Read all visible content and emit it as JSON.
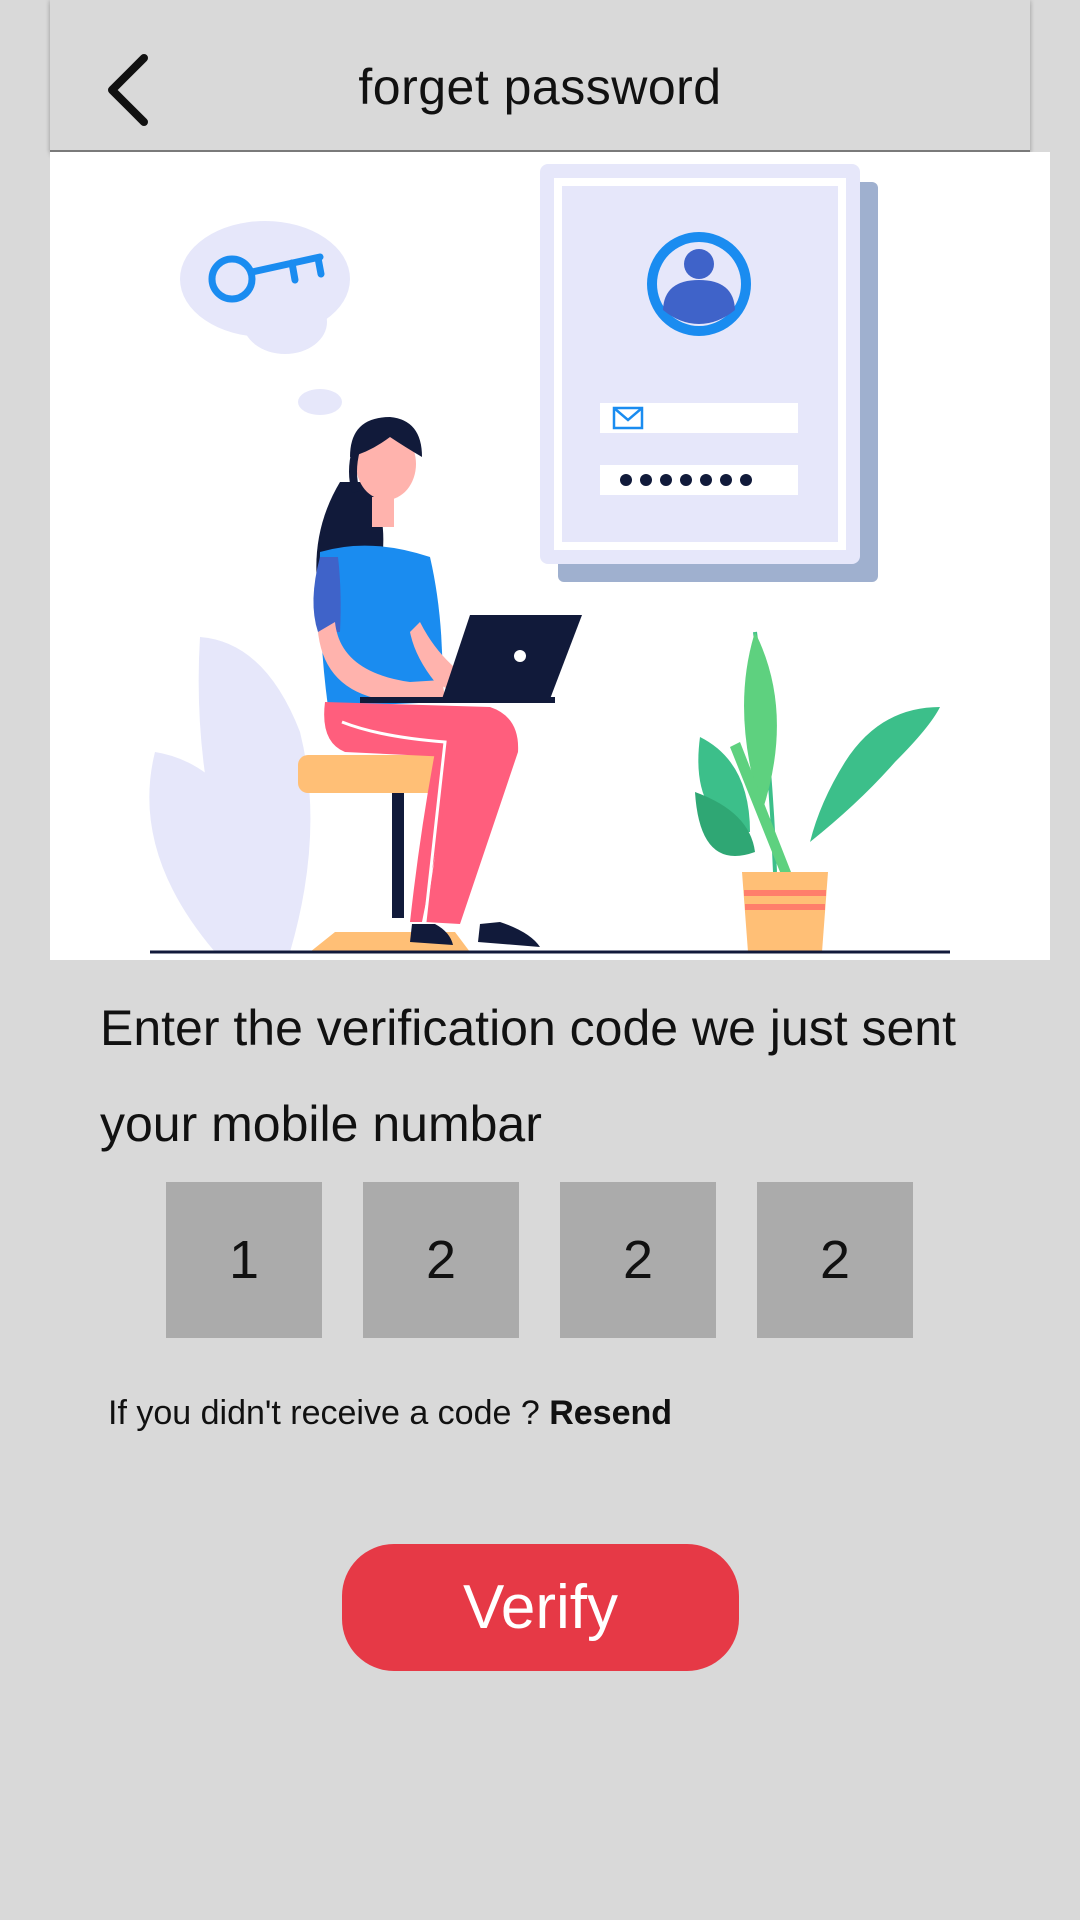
{
  "header": {
    "title": "forget password",
    "back_icon": "chevron-left-icon"
  },
  "instruction": {
    "text": "Enter the  verification code we just sent your  mobile numbar"
  },
  "otp": {
    "digits": [
      "1",
      "2",
      "2",
      "2"
    ]
  },
  "resend": {
    "prompt": "If you didn't receive a code ?",
    "link": "Resend"
  },
  "verify": {
    "label": "Verify"
  },
  "colors": {
    "background": "#d9d9d9",
    "otp_box": "#ababab",
    "verify_button": "#e63946",
    "accent_blue": "#1a8cf0"
  }
}
